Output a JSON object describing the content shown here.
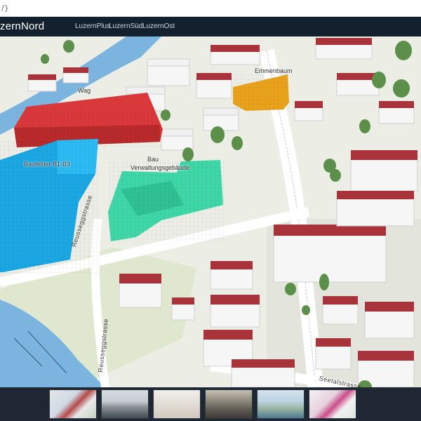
{
  "browser": {
    "url_fragment": "/}"
  },
  "header": {
    "brand": "zernNord",
    "nav": [
      {
        "label": "LuzernPlus"
      },
      {
        "label": "LuzernSüd"
      },
      {
        "label": "LuzernOst"
      }
    ]
  },
  "map": {
    "labels": {
      "emmenbaum": "Emmenbaum",
      "baufelder": "Baufelder B1-B3",
      "verwaltung": "Verwaltungsgebäude",
      "bau": "Bau",
      "wag": "Wag"
    },
    "streets": {
      "reussegg_upper": "Reusseggstrasse",
      "reussegg_lower": "Reusseggstrasse",
      "seetal": "Seetalstrasse"
    },
    "colors": {
      "red_block": "#d9393b",
      "blue_block": "#1aa7e3",
      "green_block": "#3fd6a8",
      "orange_block": "#e8a21b",
      "roof": "#a8333a",
      "tree": "#5c8f4a",
      "river": "#7ab4df",
      "ground": "#eceee6"
    }
  },
  "thumbnails": [
    {
      "name": "map-overview"
    },
    {
      "name": "building-render"
    },
    {
      "name": "model-view"
    },
    {
      "name": "facade-photo"
    },
    {
      "name": "riverfront-render"
    },
    {
      "name": "site-plan"
    }
  ]
}
